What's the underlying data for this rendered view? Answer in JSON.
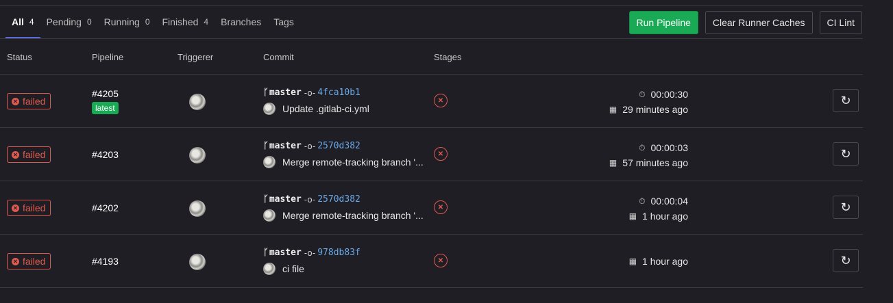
{
  "tabs": [
    {
      "label": "All",
      "count": "4"
    },
    {
      "label": "Pending",
      "count": "0"
    },
    {
      "label": "Running",
      "count": "0"
    },
    {
      "label": "Finished",
      "count": "4"
    },
    {
      "label": "Branches"
    },
    {
      "label": "Tags"
    }
  ],
  "actions": {
    "run_pipeline": "Run Pipeline",
    "clear_caches": "Clear Runner Caches",
    "ci_lint": "CI Lint"
  },
  "columns": {
    "status": "Status",
    "pipeline": "Pipeline",
    "triggerer": "Triggerer",
    "commit": "Commit",
    "stages": "Stages"
  },
  "rows": [
    {
      "status": "failed",
      "id": "#4205",
      "badge": "latest",
      "branch": "master",
      "sha": "4fca10b1",
      "message": "Update .gitlab-ci.yml",
      "duration": "00:00:30",
      "finished": "29 minutes ago"
    },
    {
      "status": "failed",
      "id": "#4203",
      "branch": "master",
      "sha": "2570d382",
      "message": "Merge remote-tracking branch '...",
      "duration": "00:00:03",
      "finished": "57 minutes ago"
    },
    {
      "status": "failed",
      "id": "#4202",
      "branch": "master",
      "sha": "2570d382",
      "message": "Merge remote-tracking branch '...",
      "duration": "00:00:04",
      "finished": "1 hour ago"
    },
    {
      "status": "failed",
      "id": "#4193",
      "branch": "master",
      "sha": "978db83f",
      "message": "ci file",
      "finished": "1 hour ago"
    }
  ],
  "colors": {
    "primary": "#1aaa55",
    "failed": "#e05a4f",
    "sha_link": "#6aa9e9",
    "active_tab_underline": "#5b6bd6",
    "background": "#1f1e24"
  }
}
